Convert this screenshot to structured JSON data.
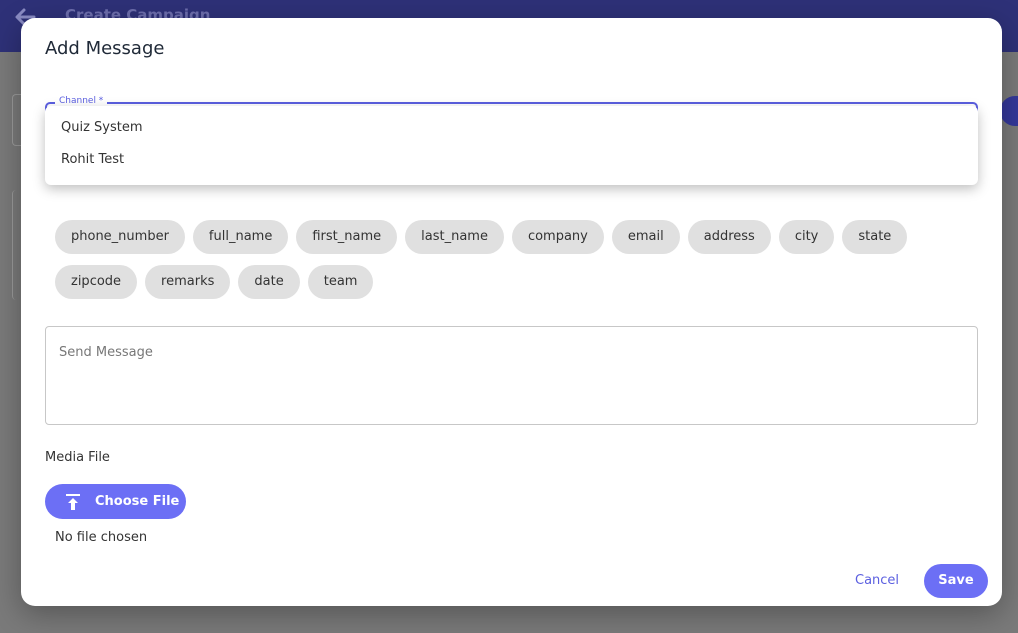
{
  "background": {
    "app_title": "Create Campaign",
    "icons": {
      "back": "arrow-left-icon"
    }
  },
  "dialog": {
    "title": "Add Message",
    "channel": {
      "label": "Channel *",
      "options": [
        "Quiz System",
        "Rohit Test"
      ]
    },
    "variables": [
      "phone_number",
      "full_name",
      "first_name",
      "last_name",
      "company",
      "email",
      "address",
      "city",
      "state",
      "zipcode",
      "remarks",
      "date",
      "team"
    ],
    "message": {
      "placeholder": "Send Message",
      "value": ""
    },
    "media": {
      "label": "Media File",
      "choose_label": "Choose File",
      "status": "No file chosen",
      "icon": "upload-icon"
    },
    "actions": {
      "cancel": "Cancel",
      "save": "Save"
    }
  },
  "colors": {
    "accent": "#6c6ff5",
    "header": "#2e3178",
    "chip": "#e0e0e0"
  }
}
